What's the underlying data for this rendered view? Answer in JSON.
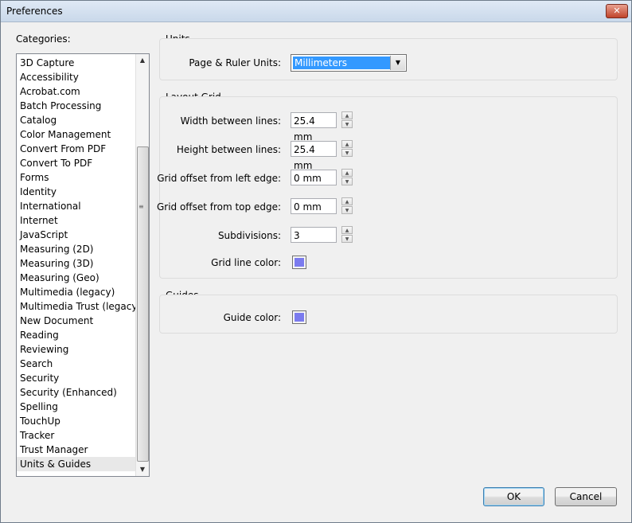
{
  "window": {
    "title": "Preferences",
    "close_glyph": "✕"
  },
  "categories": {
    "label": "Categories:",
    "items": [
      "3D Capture",
      "Accessibility",
      "Acrobat.com",
      "Batch Processing",
      "Catalog",
      "Color Management",
      "Convert From PDF",
      "Convert To PDF",
      "Forms",
      "Identity",
      "International",
      "Internet",
      "JavaScript",
      "Measuring (2D)",
      "Measuring (3D)",
      "Measuring (Geo)",
      "Multimedia (legacy)",
      "Multimedia Trust (legacy)",
      "New Document",
      "Reading",
      "Reviewing",
      "Search",
      "Security",
      "Security (Enhanced)",
      "Spelling",
      "TouchUp",
      "Tracker",
      "Trust Manager",
      "Units & Guides"
    ],
    "selected": "Units & Guides"
  },
  "units": {
    "title": "Units",
    "page_ruler_label": "Page & Ruler Units:",
    "page_ruler_value": "Millimeters"
  },
  "layout_grid": {
    "title": "Layout Grid",
    "width_label": "Width between lines:",
    "width_value": "25.4 mm",
    "height_label": "Height between lines:",
    "height_value": "25.4 mm",
    "left_offset_label": "Grid offset from left edge:",
    "left_offset_value": "0 mm",
    "top_offset_label": "Grid offset from top edge:",
    "top_offset_value": "0 mm",
    "subdivisions_label": "Subdivisions:",
    "subdivisions_value": "3",
    "line_color_label": "Grid line color:",
    "line_color": "#7b7bee"
  },
  "guides": {
    "title": "Guides",
    "color_label": "Guide color:",
    "color": "#7b7bee"
  },
  "buttons": {
    "ok": "OK",
    "cancel": "Cancel"
  }
}
